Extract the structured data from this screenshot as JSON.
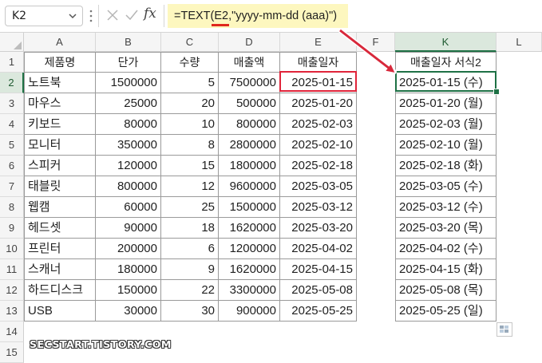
{
  "name_box": "K2",
  "formula_label": "fx",
  "formula_prefix": "=TEXT(",
  "formula_ref": "E2",
  "formula_suffix": ",\"yyyy-mm-dd (aaa)\")",
  "columns": [
    "A",
    "B",
    "C",
    "D",
    "E",
    "F",
    "K",
    "L"
  ],
  "rows": [
    "1",
    "2",
    "3",
    "4",
    "5",
    "6",
    "7",
    "8",
    "9",
    "10",
    "11",
    "12",
    "13",
    "14",
    "15"
  ],
  "headers": {
    "A": "제품명",
    "B": "단가",
    "C": "수량",
    "D": "매출액",
    "E": "매출일자",
    "K": "매출일자 서식2"
  },
  "data": [
    {
      "name": "노트북",
      "price": "1500000",
      "qty": "5",
      "sales": "7500000",
      "date": "2025-01-15",
      "fmt": "2025-01-15 (수)"
    },
    {
      "name": "마우스",
      "price": "25000",
      "qty": "20",
      "sales": "500000",
      "date": "2025-01-20",
      "fmt": "2025-01-20 (월)"
    },
    {
      "name": "키보드",
      "price": "80000",
      "qty": "10",
      "sales": "800000",
      "date": "2025-02-03",
      "fmt": "2025-02-03 (월)"
    },
    {
      "name": "모니터",
      "price": "350000",
      "qty": "8",
      "sales": "2800000",
      "date": "2025-02-10",
      "fmt": "2025-02-10 (월)"
    },
    {
      "name": "스피커",
      "price": "120000",
      "qty": "15",
      "sales": "1800000",
      "date": "2025-02-18",
      "fmt": "2025-02-18 (화)"
    },
    {
      "name": "태블릿",
      "price": "800000",
      "qty": "12",
      "sales": "9600000",
      "date": "2025-03-05",
      "fmt": "2025-03-05 (수)"
    },
    {
      "name": "웹캠",
      "price": "60000",
      "qty": "25",
      "sales": "1500000",
      "date": "2025-03-12",
      "fmt": "2025-03-12 (수)"
    },
    {
      "name": "헤드셋",
      "price": "90000",
      "qty": "18",
      "sales": "1620000",
      "date": "2025-03-20",
      "fmt": "2025-03-20 (목)"
    },
    {
      "name": "프린터",
      "price": "200000",
      "qty": "6",
      "sales": "1200000",
      "date": "2025-04-02",
      "fmt": "2025-04-02 (수)"
    },
    {
      "name": "스캐너",
      "price": "180000",
      "qty": "9",
      "sales": "1620000",
      "date": "2025-04-15",
      "fmt": "2025-04-15 (화)"
    },
    {
      "name": "하드디스크",
      "price": "150000",
      "qty": "22",
      "sales": "3300000",
      "date": "2025-05-08",
      "fmt": "2025-05-08 (목)"
    },
    {
      "name": "USB",
      "price": "30000",
      "qty": "30",
      "sales": "900000",
      "date": "2025-05-25",
      "fmt": "2025-05-25 (일)"
    }
  ],
  "watermark": "SECSTART.TISTORY.COM",
  "colors": {
    "accent": "#1e7145",
    "highlight_border": "#e0243a",
    "arrow": "#d8283b",
    "formula_bg": "#fdf7bf"
  }
}
